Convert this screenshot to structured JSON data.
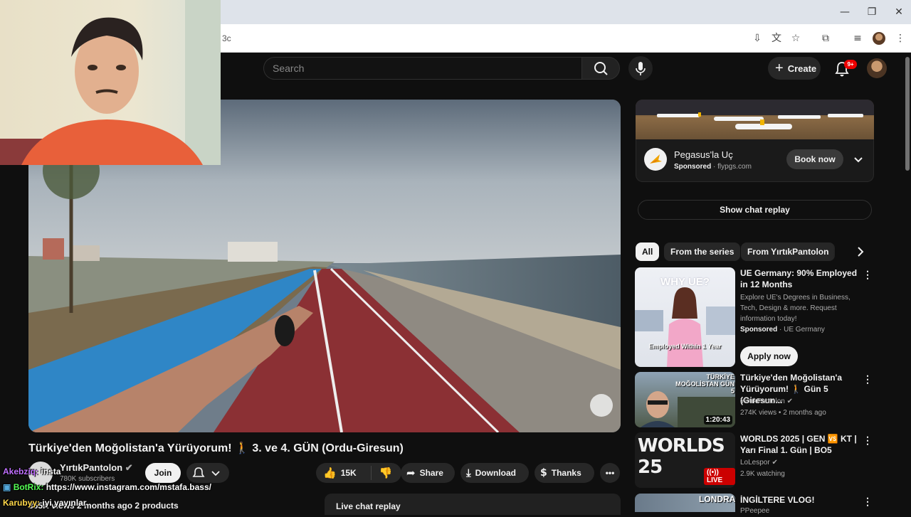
{
  "browser": {
    "address_fragment": "3c",
    "window_controls": [
      "minimize",
      "restore",
      "close"
    ]
  },
  "header": {
    "search_placeholder": "Search",
    "create_label": "Create",
    "notification_count": "9+"
  },
  "video": {
    "title": "Türkiye'den Moğolistan'a Yürüyorum! 🚶 3. ve 4. GÜN (Ordu-Giresun)",
    "channel_name": "YırtıkPantolon",
    "subscribers": "780K subscribers",
    "join_label": "Join",
    "likes": "15K",
    "share_label": "Share",
    "download_label": "Download",
    "thanks_label": "Thanks",
    "meta": "365K views  2 months ago  2 products",
    "live_chat_replay_label": "Live chat replay"
  },
  "chat_overlay": [
    {
      "user": "Akebziq",
      "message": "insta"
    },
    {
      "user": "BotRix",
      "message": "https://www.instagram.com/mstafa.bass/"
    },
    {
      "user": "Karubyy",
      "message": "iyi yayınlar"
    }
  ],
  "sidebar": {
    "ad": {
      "title": "Pegasus'la Uç",
      "sponsored": "Sponsored",
      "domain": "flypgs.com",
      "cta": "Book now"
    },
    "show_chat_label": "Show chat replay",
    "chips": [
      "All",
      "From the series",
      "From YırtıkPantolon"
    ],
    "items": [
      {
        "title": "UE Germany: 90% Employed in 12 Months",
        "description": "Explore UE's Degrees in Business, Tech, Design & more. Request information today!",
        "sponsored": "Sponsored",
        "advertiser": "UE Germany",
        "thumb_caption": "Employed Within 1 Year",
        "thumb_heading": "WHY UE?",
        "cta": "Apply now"
      },
      {
        "title": "Türkiye'den Moğolistan'a Yürüyorum! 🚶 Gün 5 (Giresun...",
        "channel": "YırtıkPantolon",
        "meta": "274K views • 2 months ago",
        "duration": "1:20:43",
        "thumb_text": "TÜRKİYE MOĞOLİSTAN GÜN 5"
      },
      {
        "title": "WORLDS 2025 | GEN 🆚 KT | Yarı Final 1. Gün | BO5",
        "channel": "LoLespor",
        "meta": "2.9K watching",
        "badge": "LIVE",
        "thumb_text": "WORLDS 25"
      },
      {
        "title": "İNGİLTERE VLOG!",
        "channel": "PPeepee",
        "thumb_text": "LONDRA"
      }
    ]
  },
  "colors": {
    "background": "#0f0f0f",
    "accent_red": "#ff0033",
    "pill": "#272727"
  }
}
